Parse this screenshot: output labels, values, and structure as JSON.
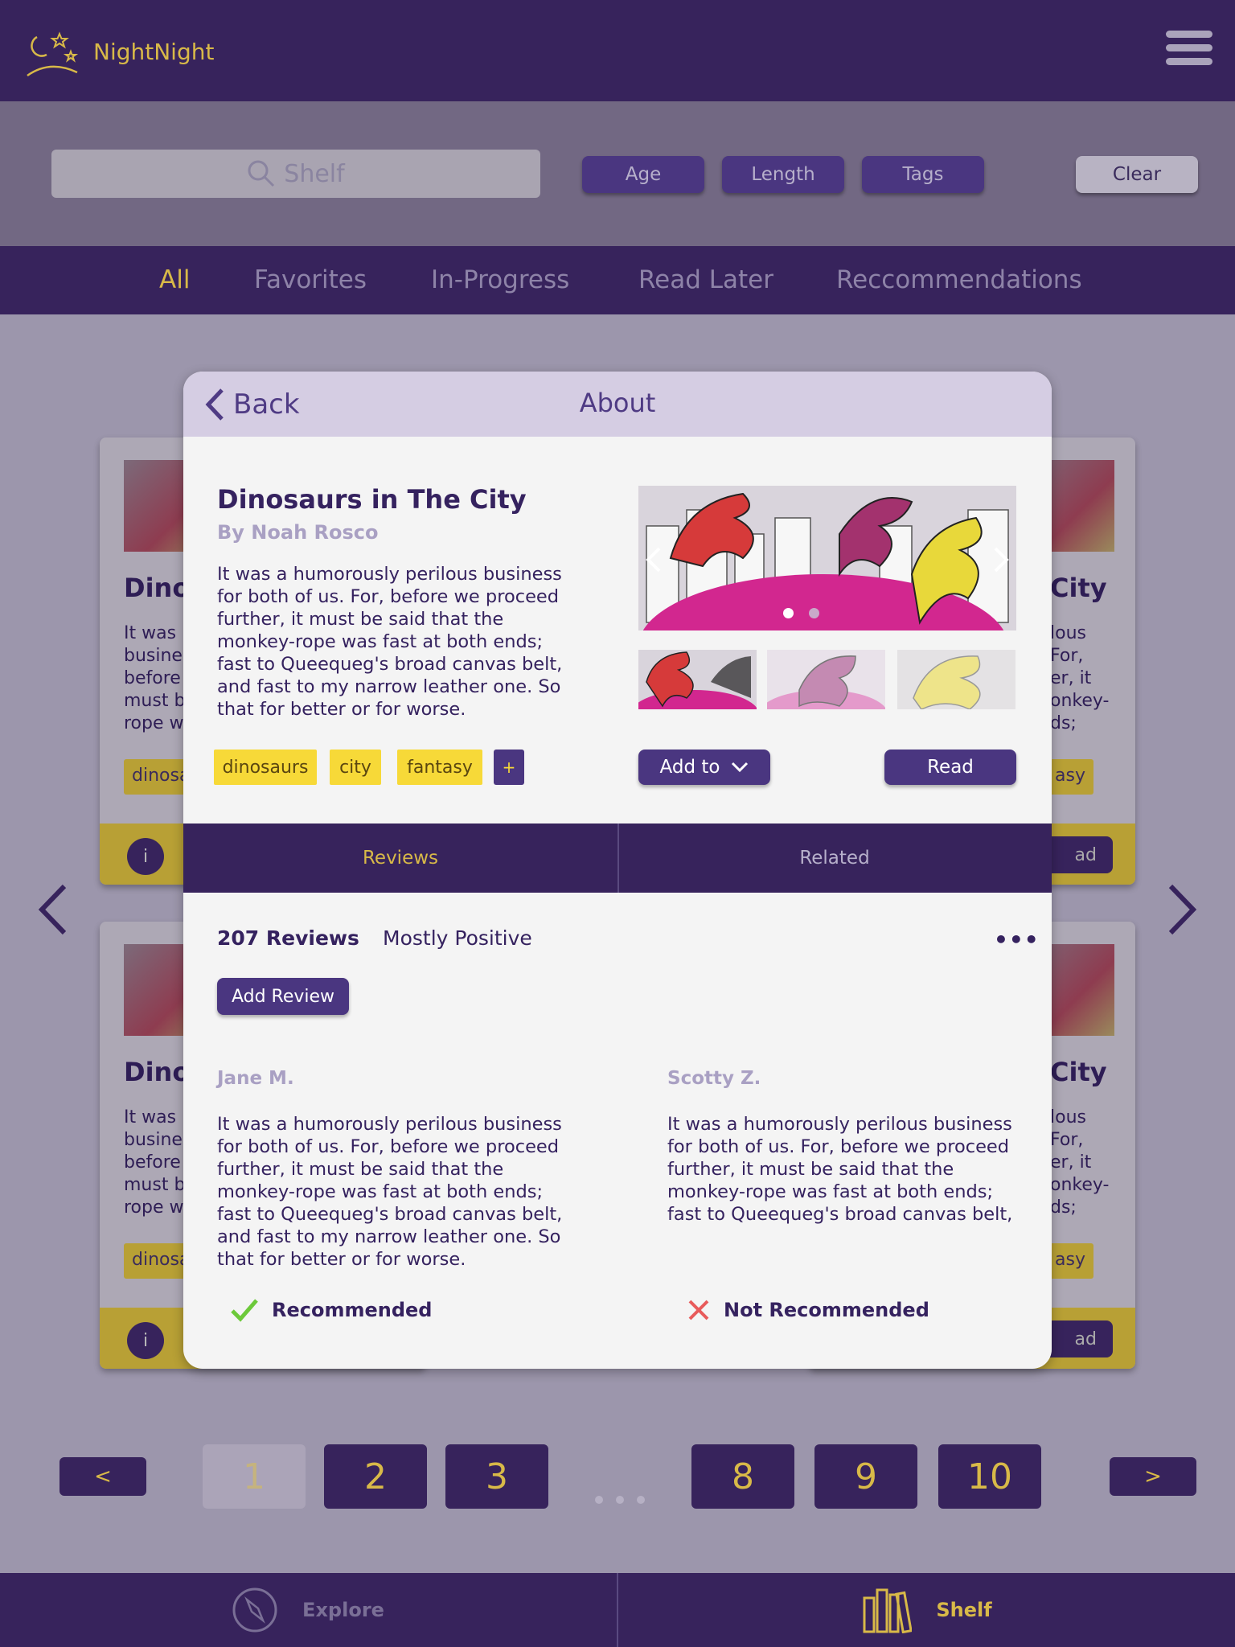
{
  "header": {
    "app_title": "NightNight"
  },
  "filters": {
    "search_placeholder": "Shelf",
    "chips": [
      "Age",
      "Length",
      "Tags"
    ],
    "clear_label": "Clear"
  },
  "tabs": [
    "All",
    "Favorites",
    "In-Progress",
    "Read Later",
    "Reccommendations"
  ],
  "background_cards": {
    "left_title": "Dino",
    "right_title": "City",
    "left_text": "It was\nbusine\nbefore\nmust b\nrope w",
    "right_text": "lous\nFor,\ner, it\nonkey-\nds;",
    "left_tag": "dinosa",
    "right_tag": "asy",
    "info_label": "i",
    "read_label": "ad"
  },
  "modal": {
    "back_label": "Back",
    "heading": "About",
    "book_title": "Dinosaurs in The City",
    "author": "By Noah Rosco",
    "description": "It was a humorously perilous business for both of us. For, before we proceed further, it must be said that the monkey-rope was fast at both ends; fast to Queequeg's broad canvas belt, and fast to my narrow leather one. So that for better or for worse.",
    "tags": [
      "dinosaurs",
      "city",
      "fantasy"
    ],
    "tag_more": "+",
    "add_to_label": "Add to",
    "read_label": "Read",
    "sub_tabs": [
      "Reviews",
      "Related"
    ],
    "review_count": "207 Reviews",
    "review_summary": "Mostly Positive",
    "add_review_label": "Add Review",
    "reviews": [
      {
        "name": "Jane M.",
        "text": "It was a humorously perilous business for both of us. For, before we proceed further, it must be said that the monkey-rope was fast at both ends; fast to Queequeg's broad canvas belt, and fast to my narrow leather one. So that for better or for worse.",
        "verdict": "Recommended"
      },
      {
        "name": "Scotty Z.",
        "text": "It was a humorously perilous business for both of us. For, before we proceed further, it must be said that the monkey-rope was fast at both ends; fast to Queequeg's broad canvas belt,",
        "verdict": "Not Recommended"
      }
    ]
  },
  "pagination": {
    "prev": "<",
    "next": ">",
    "pages": [
      "1",
      "2",
      "3",
      "8",
      "9",
      "10"
    ],
    "current": "1"
  },
  "bottom_nav": [
    "Explore",
    "Shelf"
  ],
  "colors": {
    "primary": "#37235c",
    "accent": "#d8b948",
    "tag": "#f7d938",
    "recommended": "#6cc93a",
    "not_recommended": "#e85a5a"
  }
}
